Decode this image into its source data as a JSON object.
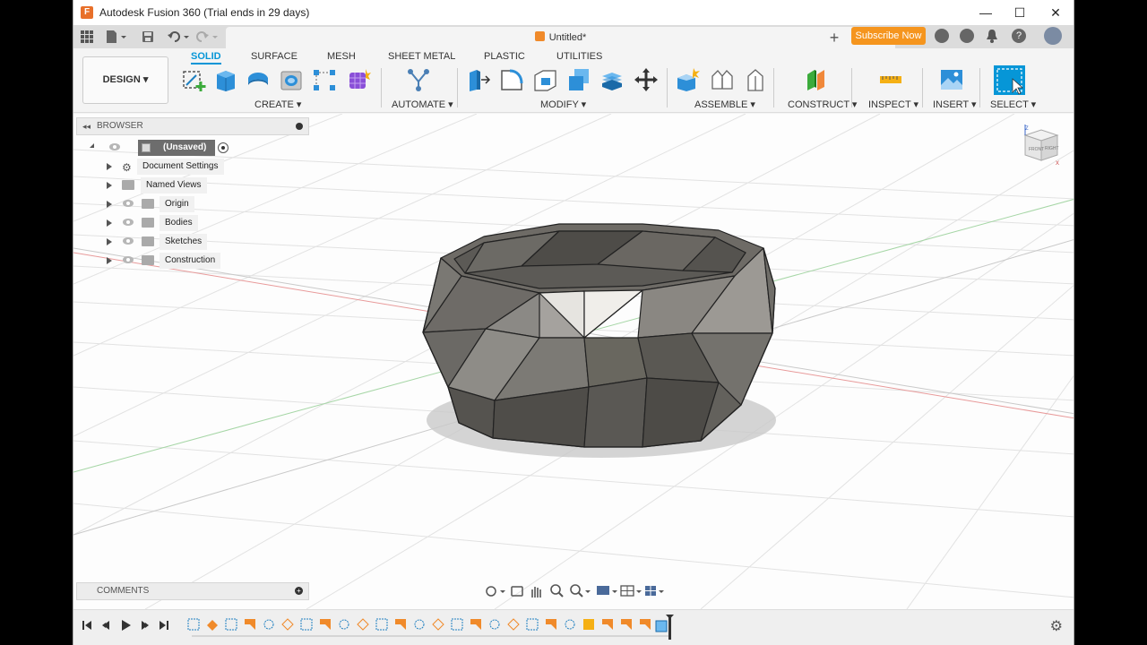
{
  "window": {
    "title": "Autodesk Fusion 360 (Trial ends in 29 days)",
    "logo_letter": "F",
    "minimize": "—",
    "maximize": "☐",
    "close": "✕"
  },
  "header": {
    "doc_tab_title": "Untitled*",
    "doc_tab_close": "✕",
    "new_tab": "+",
    "subscribe_label": "Subscribe Now",
    "icons": [
      "extensions-icon",
      "job-status-icon",
      "notifications-icon",
      "help-icon",
      "avatar"
    ],
    "help_glyph": "?"
  },
  "ribbon": {
    "workspace_label": "DESIGN ▾",
    "tabs": [
      "SOLID",
      "SURFACE",
      "MESH",
      "SHEET METAL",
      "PLASTIC",
      "UTILITIES"
    ],
    "active_tab": "SOLID",
    "groups": [
      "CREATE ▾",
      "AUTOMATE ▾",
      "MODIFY ▾",
      "ASSEMBLE ▾",
      "CONSTRUCT ▾",
      "INSPECT ▾",
      "INSERT ▾",
      "SELECT ▾"
    ],
    "accent": "#0696d7"
  },
  "browser": {
    "title": "BROWSER",
    "root": "(Unsaved)",
    "items": [
      "Document Settings",
      "Named Views",
      "Origin",
      "Bodies",
      "Sketches",
      "Construction"
    ]
  },
  "comments": {
    "title": "COMMENTS"
  },
  "viewcube": {
    "faces": [
      "FRONT",
      "RIGHT"
    ],
    "axes": [
      "Z",
      "X"
    ]
  },
  "timeline": {
    "gear_glyph": "⚙"
  }
}
